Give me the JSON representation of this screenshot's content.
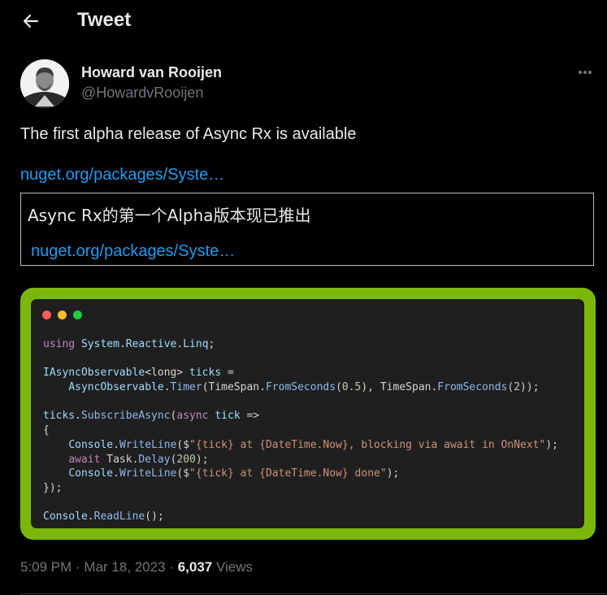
{
  "header": {
    "title": "Tweet"
  },
  "author": {
    "name": "Howard van Rooijen",
    "handle": "@HowardvRooijen"
  },
  "tweet": {
    "text": "The first alpha release of Async Rx is available",
    "link": "nuget.org/packages/Syste…"
  },
  "translation": {
    "text": "Async Rx的第一个Alpha版本现已推出",
    "link": "nuget.org/packages/Syste…"
  },
  "code_image": {
    "lines": [
      [
        [
          "kw",
          "using"
        ],
        [
          "pl",
          " "
        ],
        [
          "ty",
          "System"
        ],
        [
          "pl",
          "."
        ],
        [
          "ty",
          "Reactive"
        ],
        [
          "pl",
          "."
        ],
        [
          "ty",
          "Linq"
        ],
        [
          "pl",
          ";"
        ]
      ],
      [],
      [
        [
          "ty",
          "IAsyncObservable"
        ],
        [
          "pl",
          "<long> "
        ],
        [
          "ty",
          "ticks"
        ],
        [
          "pl",
          " ="
        ]
      ],
      [
        [
          "pl",
          "    "
        ],
        [
          "ty",
          "AsyncObservable"
        ],
        [
          "pl",
          "."
        ],
        [
          "fn",
          "Timer"
        ],
        [
          "pl",
          "(TimeSpan."
        ],
        [
          "fn",
          "FromSeconds"
        ],
        [
          "pl",
          "("
        ],
        [
          "num",
          "0.5"
        ],
        [
          "pl",
          "), TimeSpan."
        ],
        [
          "fn",
          "FromSeconds"
        ],
        [
          "pl",
          "("
        ],
        [
          "num",
          "2"
        ],
        [
          "pl",
          "));"
        ]
      ],
      [],
      [
        [
          "ty",
          "ticks"
        ],
        [
          "pl",
          "."
        ],
        [
          "fn",
          "SubscribeAsync"
        ],
        [
          "pl",
          "("
        ],
        [
          "kw",
          "async"
        ],
        [
          "pl",
          " "
        ],
        [
          "ty",
          "tick"
        ],
        [
          "pl",
          " =>"
        ]
      ],
      [
        [
          "pl",
          "{"
        ]
      ],
      [
        [
          "pl",
          "    "
        ],
        [
          "ty",
          "Console"
        ],
        [
          "pl",
          "."
        ],
        [
          "fn",
          "WriteLine"
        ],
        [
          "pl",
          "($"
        ],
        [
          "str",
          "\"{tick} at {DateTime.Now}, blocking via await in OnNext\""
        ],
        [
          "pl",
          ");"
        ]
      ],
      [
        [
          "pl",
          "    "
        ],
        [
          "kw",
          "await"
        ],
        [
          "pl",
          " Task."
        ],
        [
          "fn",
          "Delay"
        ],
        [
          "pl",
          "("
        ],
        [
          "num",
          "200"
        ],
        [
          "pl",
          ");"
        ]
      ],
      [
        [
          "pl",
          "    "
        ],
        [
          "ty",
          "Console"
        ],
        [
          "pl",
          "."
        ],
        [
          "fn",
          "WriteLine"
        ],
        [
          "pl",
          "($"
        ],
        [
          "str",
          "\"{tick} at {DateTime.Now} done\""
        ],
        [
          "pl",
          ");"
        ]
      ],
      [
        [
          "pl",
          "});"
        ]
      ],
      [],
      [
        [
          "ty",
          "Console"
        ],
        [
          "pl",
          "."
        ],
        [
          "fn",
          "ReadLine"
        ],
        [
          "pl",
          "();"
        ]
      ]
    ]
  },
  "meta": {
    "time": "5:09 PM",
    "separator": " · ",
    "date": "Mar 18, 2023",
    "views_count": "6,037",
    "views_label": " Views"
  },
  "colors": {
    "background": "#000000",
    "link": "#1d9bf0",
    "frame": "#7bb70b",
    "code_bg": "#1f1f1f"
  },
  "icons": [
    "back-arrow-icon",
    "more-options-icon"
  ]
}
